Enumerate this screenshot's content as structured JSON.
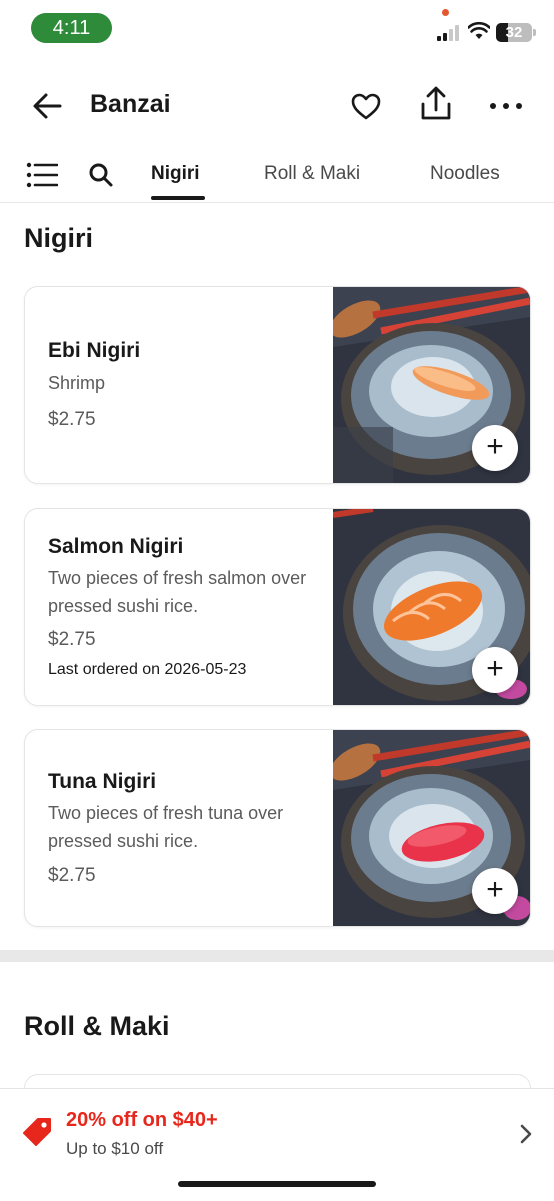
{
  "status_bar": {
    "time": "4:11",
    "battery": "32"
  },
  "header": {
    "title": "Banzai"
  },
  "tabs": [
    {
      "label": "Nigiri",
      "active": true
    },
    {
      "label": "Roll & Maki",
      "active": false
    },
    {
      "label": "Noodles",
      "active": false
    }
  ],
  "sections": {
    "nigiri_title": "Nigiri",
    "roll_title": "Roll & Maki"
  },
  "items": [
    {
      "name": "Ebi Nigiri",
      "description": "Shrimp",
      "price": "$2.75",
      "note": ""
    },
    {
      "name": "Salmon Nigiri",
      "description": "Two pieces of fresh salmon over pressed sushi rice.",
      "price": "$2.75",
      "note": "Last ordered on 2026-05-23"
    },
    {
      "name": "Tuna Nigiri",
      "description": "Two pieces of fresh tuna over pressed sushi rice.",
      "price": "$2.75",
      "note": ""
    }
  ],
  "promo": {
    "title": "20% off on $40+",
    "subtitle": "Up to $10 off"
  },
  "colors": {
    "accent": "#e8271c",
    "status_green": "#2e8b3a"
  },
  "icons": [
    "back-arrow-icon",
    "heart-icon",
    "share-icon",
    "more-icon",
    "list-icon",
    "search-icon",
    "plus-icon",
    "tag-icon",
    "chevron-right-icon"
  ]
}
